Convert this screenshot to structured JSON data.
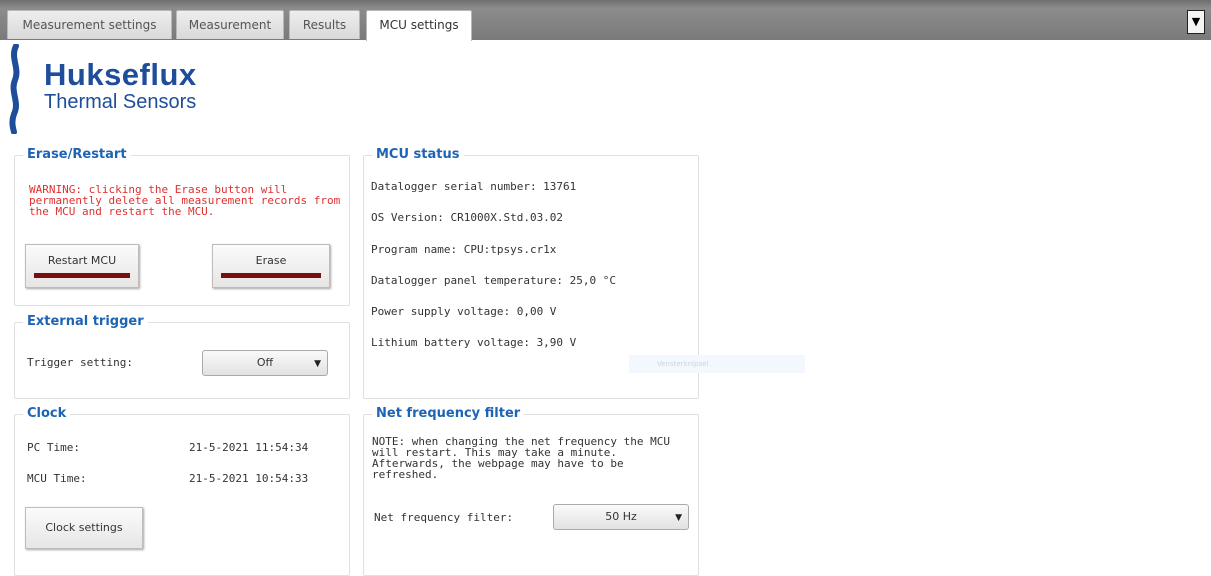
{
  "tabs": [
    {
      "label": "Measurement settings"
    },
    {
      "label": "Measurement"
    },
    {
      "label": "Results"
    },
    {
      "label": "MCU settings"
    }
  ],
  "menu_toggle": "▼",
  "logo": {
    "title": "Hukseflux",
    "subtitle": "Thermal Sensors",
    "color": "#1e4d9b"
  },
  "erase_restart": {
    "title": "Erase/Restart",
    "warning": "WARNING: clicking the Erase button will permanently delete all measurement records from the MCU and restart the MCU.",
    "restart_label": "Restart MCU",
    "erase_label": "Erase"
  },
  "external_trigger": {
    "title": "External trigger",
    "label": "Trigger setting:",
    "value": "Off"
  },
  "clock": {
    "title": "Clock",
    "pc_label": "PC Time:",
    "pc_value": "21-5-2021 11:54:34",
    "mcu_label": "MCU Time:",
    "mcu_value": "21-5-2021 10:54:33",
    "settings_label": "Clock settings"
  },
  "mcu_status": {
    "title": "MCU status",
    "lines": [
      "Datalogger serial number: 13761",
      "OS Version: CR1000X.Std.03.02",
      "Program name: CPU:tpsys.cr1x",
      "Datalogger panel temperature: 25,0 °C",
      "Power supply voltage: 0,00 V",
      "Lithium battery voltage: 3,90 V"
    ]
  },
  "ghost_tooltip": "Vensterknipsel",
  "net_frequency": {
    "title": "Net frequency filter",
    "note": "NOTE: when changing the net frequency the MCU will restart. This may take a minute. Afterwards, the webpage may have to be refreshed.",
    "label": "Net frequency filter:",
    "value": "50 Hz"
  },
  "colors": {
    "accent": "#1e64b4",
    "warning": "#e03030",
    "bar": "#7a0e0e"
  }
}
